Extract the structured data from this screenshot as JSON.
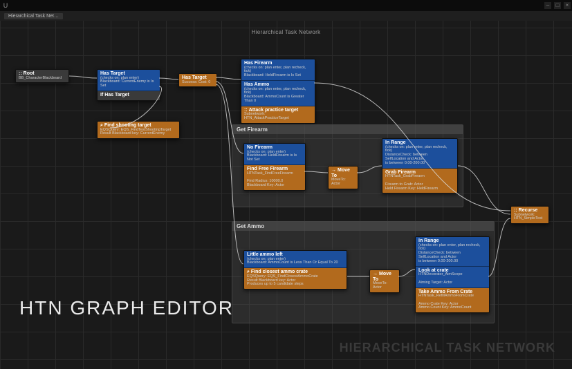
{
  "window": {
    "title_center": "Hierarchical Task Network",
    "tab_label": "Hierarchical Task Net…",
    "logo": "U"
  },
  "labels": {
    "big": "HTN GRAPH EDITOR",
    "footer": "HIERARCHICAL TASK NETWORK"
  },
  "root": {
    "title": "Root",
    "sub": "BB_CharacterBlackboard",
    "icon": "::"
  },
  "hasTargetNode": {
    "hasTarget": {
      "title": "Has Target",
      "sub": "(checks on: plan enter)\nBlackboard: CurrentEnemy is Is Set"
    },
    "ifHasTarget": {
      "title": "If Has Target"
    }
  },
  "hasTargetOrange": {
    "title": "Has Target",
    "sub": "Success: Cost: 0"
  },
  "findShooting": {
    "title": "Find shooting target",
    "sub": "EQSQuery: EQS_FindTestShootingTarget\nResult Blackboard key: CurrentEnemy",
    "icon": "⌕"
  },
  "attackCluster": {
    "hasFirearm": {
      "title": "Has Firearm",
      "sub": "(checks on: plan enter, plan recheck, tick)\nBlackboard: HeldFirearm is Is Set"
    },
    "hasAmmo": {
      "title": "Has Ammo",
      "sub": "(checks on: plan enter, plan recheck, tick)\nBlackboard: AmmoCount is Greater Than 0"
    },
    "attack": {
      "title": "Attack practice target",
      "sub": "Subnetwork:\nHTN_AttackPracticeTarget",
      "icon": "::"
    }
  },
  "groups": {
    "getFirearm": "Get Firearm",
    "getAmmo": "Get Ammo"
  },
  "getFirearm": {
    "noFirearm": {
      "title": "No Firearm",
      "sub": "(checks on: plan enter)\nBlackboard: HeldFirearm is Is Not Set"
    },
    "findFree": {
      "title": "Find Free Firearm",
      "sub": "HTNTask_FindFreeFirearm\n\nFind Radius: 10000.0\nBlackboard Key: Actor"
    },
    "moveTo": {
      "title": "Move To",
      "sub": "MoveTo: Actor",
      "arrow": "→"
    },
    "inRange": {
      "title": "In Range",
      "sub": "(checks on: plan enter, plan recheck, tick)\nDistanceCheck: between\nSelfLocation and Actor\nis between 0.00-200.00"
    },
    "grab": {
      "title": "Grab Firearm",
      "sub": "HTNTask_GrabFirearm\n\nFirearm to Grab: Actor\nHeld Firearm Key: HeldFirearm"
    }
  },
  "getAmmo": {
    "littleAmmo": {
      "title": "Little ammo left",
      "sub": "(checks on: plan enter)\nBlackboard: AmmoCount is Less Than Or Equal To 20"
    },
    "findCrate": {
      "title": "Find closest ammo crate",
      "sub": "EQSQuery: EQS_FindClosestAmmoCrate\nResult Blackboard key: Actor\nProduces up to 5 candidate steps",
      "icon": "⌕"
    },
    "moveTo": {
      "title": "Move To",
      "sub": "MoveTo: Actor",
      "arrow": "→"
    },
    "inRange": {
      "title": "In Range",
      "sub": "(checks on: plan enter, plan recheck, tick)\nDistanceCheck: between\nSelfLocation and Actor\nis between 0.00-200.00"
    },
    "look": {
      "title": "Look at crate",
      "sub": "HTNDecorator_AimScope\n\nAiming Target: Actor"
    },
    "take": {
      "title": "Take Ammo From Crate",
      "sub": "HTNTask_RefillAmmoFromCrate\n\nAmmo Crate Key: Actor\nAmmo Count Key: AmmoCount"
    }
  },
  "recurse": {
    "title": "Recurse",
    "sub": "Subnetwork:\nHTN_SimpleTest",
    "icon": "::"
  }
}
